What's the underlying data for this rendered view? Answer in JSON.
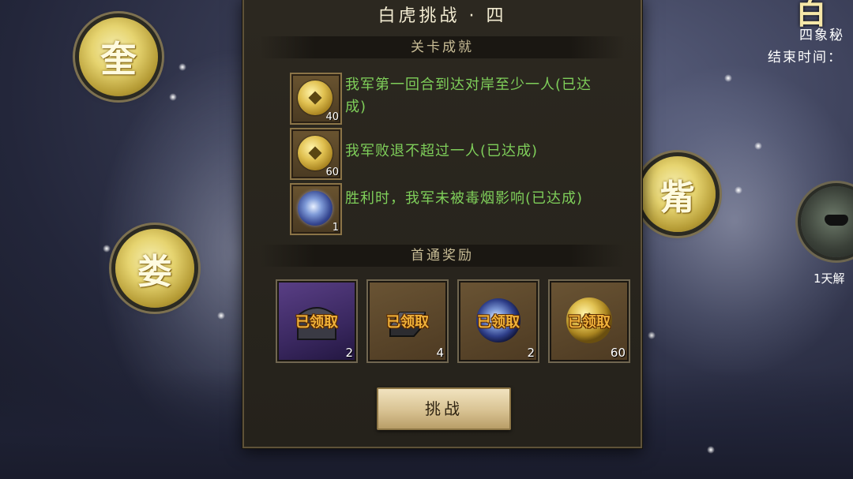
{
  "panel": {
    "title": "白虎挑战 · 四",
    "achievements_header": "关卡成就",
    "achievements": [
      {
        "icon": "coin-icon",
        "count": "40",
        "text": "我军第一回合到达对岸至少一人(已达成)"
      },
      {
        "icon": "coin-icon",
        "count": "60",
        "text": "我军败退不超过一人(已达成)"
      },
      {
        "icon": "orb-icon",
        "count": "1",
        "text": "胜利时，我军未被毒烟影响(已达成)"
      }
    ],
    "rewards_header": "首通奖励",
    "rewards": [
      {
        "icon": "chest-icon",
        "status": "已领取",
        "count": "2"
      },
      {
        "icon": "iron-ingot-icon",
        "status": "已领取",
        "count": "4"
      },
      {
        "icon": "orb-icon",
        "status": "已领取",
        "count": "2"
      },
      {
        "icon": "coin-icon",
        "status": "已领取",
        "count": "60"
      }
    ],
    "challenge_button": "挑战"
  },
  "map": {
    "nodes": [
      {
        "label": "奎"
      },
      {
        "label": "娄"
      },
      {
        "label": "觜"
      }
    ],
    "jade_label": "1天解",
    "top_right_title": "白",
    "top_right_subtitle": "四象秘",
    "top_right_end_time": "结束时间："
  },
  "colors": {
    "achievement_text": "#7fcf5a",
    "claimed_text": "#f0b23a",
    "panel_bg": "#2a261e"
  }
}
